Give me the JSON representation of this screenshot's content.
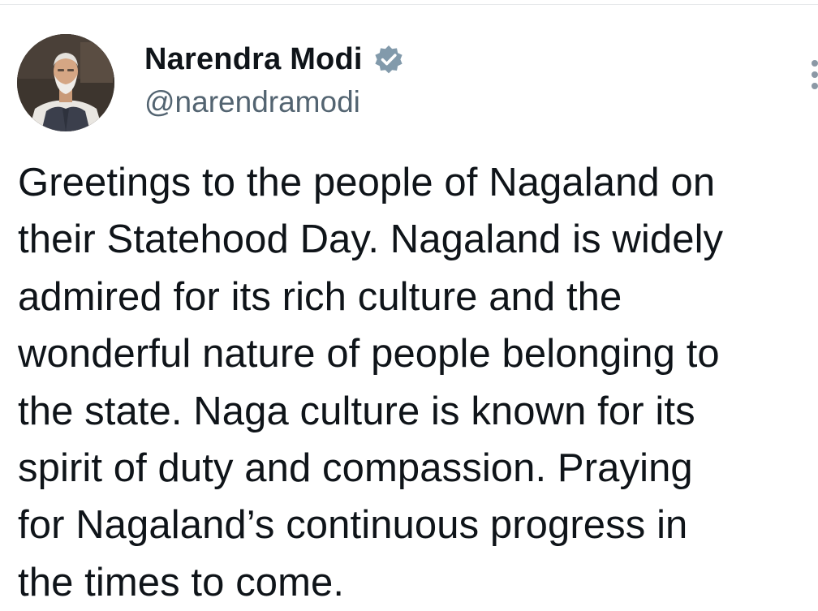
{
  "author": {
    "display_name": "Narendra Modi",
    "handle": "@narendramodi",
    "verified_icon": "verified-badge-icon",
    "avatar_icon": "profile-photo"
  },
  "menu": {
    "icon": "more-options-icon"
  },
  "tweet": {
    "lines": [
      "Greetings to the people of Nagaland on",
      "their Statehood Day. Nagaland is widely",
      "admired for its rich culture and the",
      "wonderful nature of people belonging to",
      "the state. Naga culture is known for its",
      "spirit of duty and compassion. Praying",
      "for Nagaland’s continuous progress in",
      "the times to come."
    ]
  },
  "colors": {
    "text_primary": "#0f1419",
    "text_secondary": "#536471",
    "verified_badge": "#829aab"
  }
}
